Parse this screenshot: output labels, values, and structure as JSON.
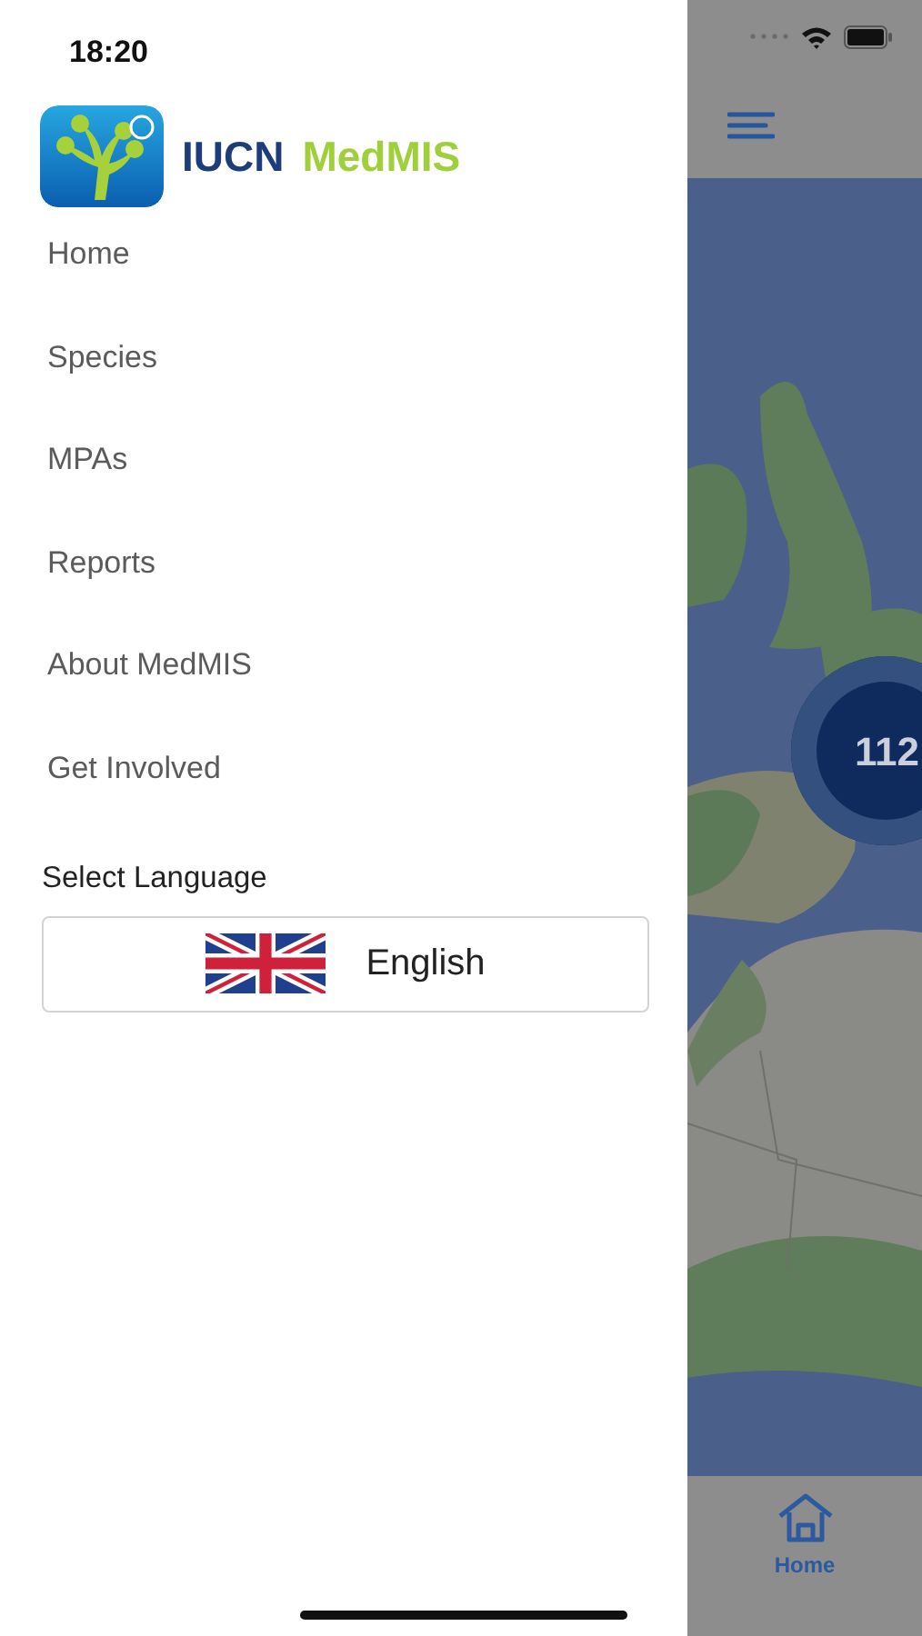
{
  "status_bar": {
    "time": "18:20"
  },
  "drawer": {
    "logo": {
      "org": "IUCN",
      "name": "MedMIS"
    },
    "menu": [
      {
        "label": "Home"
      },
      {
        "label": "Species"
      },
      {
        "label": "MPAs"
      },
      {
        "label": "Reports"
      },
      {
        "label": "About MedMIS"
      },
      {
        "label": "Get Involved"
      }
    ],
    "language": {
      "label": "Select Language",
      "value": "English"
    }
  },
  "map": {
    "cluster_count": "112"
  },
  "tab_bar": [
    {
      "label": "Home",
      "selected": true
    }
  ]
}
